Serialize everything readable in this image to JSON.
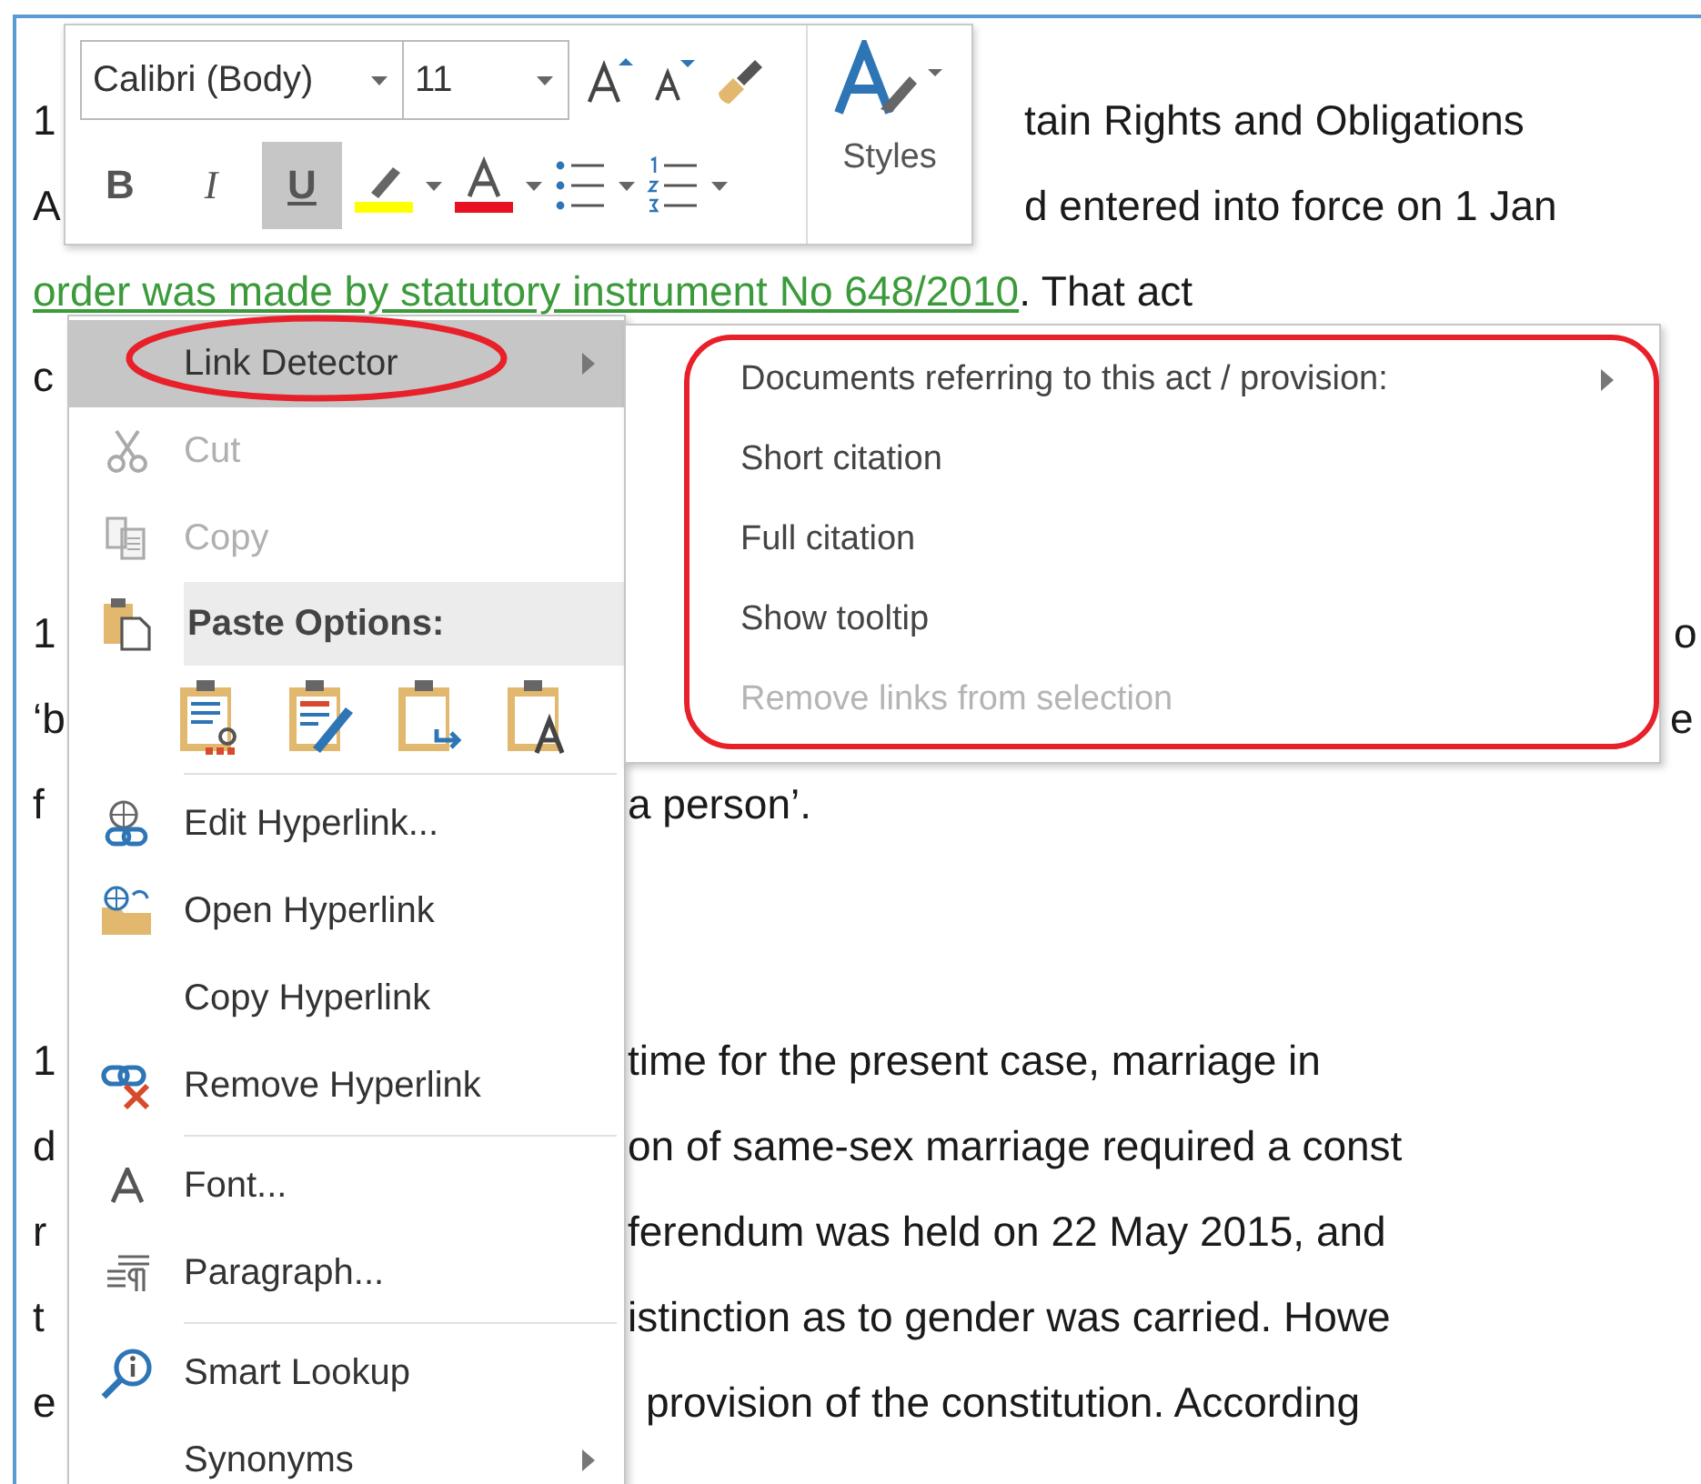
{
  "document": {
    "paragraphs": [
      {
        "lines": [
          {
            "parts": [
              {
                "text": "1"
              },
              {
                "text": "tain Rights and Obligations"
              }
            ]
          },
          {
            "parts": [
              {
                "text": "A"
              },
              {
                "text": "d entered into force on 1 Jan"
              }
            ]
          },
          {
            "parts": [
              {
                "text": "order was made by statutory instrument No 648/2010",
                "link": true
              },
              {
                "text": ". That act"
              }
            ]
          },
          {
            "parts": [
              {
                "text": "c"
              }
            ]
          }
        ]
      },
      {
        "lines": [
          {
            "parts": [
              {
                "text": "1"
              },
              {
                "text": "o"
              }
            ]
          },
          {
            "parts": [
              {
                "text": "‘b"
              },
              {
                "text": "e"
              }
            ]
          },
          {
            "parts": [
              {
                "text": "f"
              },
              {
                "text": "a person’."
              }
            ]
          }
        ]
      },
      {
        "lines": [
          {
            "parts": [
              {
                "text": "1"
              },
              {
                "text": "time for the present case, marriage in"
              }
            ]
          },
          {
            "parts": [
              {
                "text": "d"
              },
              {
                "text": "on of same-sex marriage required a const"
              }
            ]
          },
          {
            "parts": [
              {
                "text": "r"
              },
              {
                "text": "ferendum was held on 22 May 2015, and"
              }
            ]
          },
          {
            "parts": [
              {
                "text": "t"
              },
              {
                "text": "istinction as to gender was carried. Howe"
              }
            ]
          },
          {
            "parts": [
              {
                "text": "e"
              },
              {
                "text": "provision of the constitution. According"
              }
            ]
          }
        ]
      }
    ]
  },
  "mini_toolbar": {
    "font": {
      "value": "Calibri (Body)"
    },
    "size": {
      "value": "11"
    },
    "format_buttons": [
      {
        "kind": "bold",
        "label": "B",
        "selected": false
      },
      {
        "kind": "italic",
        "label": "I",
        "selected": false
      },
      {
        "kind": "underline",
        "label": "U",
        "selected": true
      }
    ],
    "styles_label": "Styles"
  },
  "context_menu": {
    "items": [
      {
        "kind": "item",
        "label": "Link Detector",
        "selected": true,
        "disabled": false,
        "submenu": true
      },
      {
        "kind": "item",
        "label": "Cut",
        "selected": false,
        "disabled": true,
        "submenu": false
      },
      {
        "kind": "item",
        "label": "Copy",
        "selected": false,
        "disabled": true,
        "submenu": false
      },
      {
        "kind": "header",
        "label": "Paste Options:"
      },
      {
        "kind": "paste-options"
      },
      {
        "kind": "separator"
      },
      {
        "kind": "item",
        "label": "Edit Hyperlink...",
        "selected": false,
        "disabled": false,
        "submenu": false
      },
      {
        "kind": "item",
        "label": "Open Hyperlink",
        "selected": false,
        "disabled": false,
        "submenu": false
      },
      {
        "kind": "item",
        "label": "Copy Hyperlink",
        "selected": false,
        "disabled": false,
        "submenu": false
      },
      {
        "kind": "item",
        "label": "Remove Hyperlink",
        "selected": false,
        "disabled": false,
        "submenu": false
      },
      {
        "kind": "separator"
      },
      {
        "kind": "item",
        "label": "Font...",
        "selected": false,
        "disabled": false,
        "submenu": false
      },
      {
        "kind": "item",
        "label": "Paragraph...",
        "selected": false,
        "disabled": false,
        "submenu": false
      },
      {
        "kind": "separator"
      },
      {
        "kind": "item",
        "label": "Smart Lookup",
        "selected": false,
        "disabled": false,
        "submenu": false
      },
      {
        "kind": "item",
        "label": "Synonyms",
        "selected": false,
        "disabled": false,
        "submenu": true
      }
    ]
  },
  "submenu": {
    "items": [
      {
        "label": "Documents referring to this act / provision:",
        "disabled": false,
        "submenu": true
      },
      {
        "label": "Short citation",
        "disabled": false,
        "submenu": false
      },
      {
        "label": "Full citation",
        "disabled": false,
        "submenu": false
      },
      {
        "label": "Show tooltip",
        "disabled": false,
        "submenu": false
      },
      {
        "label": "Remove links from selection",
        "disabled": true,
        "submenu": false
      }
    ]
  },
  "annotations": [
    {
      "kind": "ellipse"
    },
    {
      "kind": "rounded-rect"
    }
  ]
}
